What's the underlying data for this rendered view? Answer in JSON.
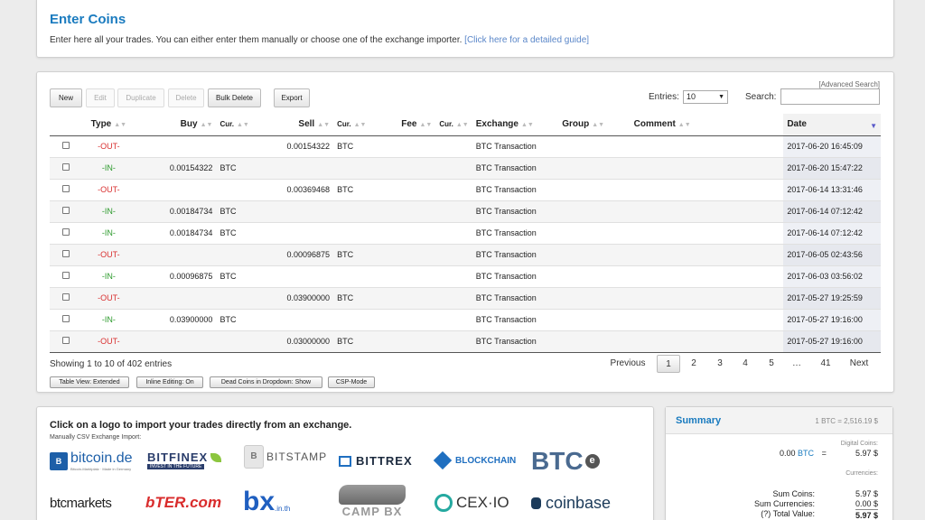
{
  "header": {
    "title": "Enter Coins",
    "description": "Enter here all your trades. You can either enter them manually or choose one of the exchange importer.",
    "guide_link": "[Click here for a detailed guide]"
  },
  "toolbar": {
    "new": "New",
    "edit": "Edit",
    "duplicate": "Duplicate",
    "delete": "Delete",
    "bulk_delete": "Bulk Delete",
    "export": "Export",
    "advanced_search": "[Advanced Search]",
    "entries_label": "Entries:",
    "entries_value": "10",
    "search_label": "Search:"
  },
  "table": {
    "columns": [
      "Type",
      "Buy",
      "Cur.",
      "Sell",
      "Cur.",
      "Fee",
      "Cur.",
      "Exchange",
      "Group",
      "Comment",
      "Date"
    ],
    "rows": [
      {
        "type": "-OUT-",
        "buy": "",
        "buy_cur": "",
        "sell": "0.00154322",
        "sell_cur": "BTC",
        "exchange": "BTC Transaction",
        "date": "2017-06-20 16:45:09"
      },
      {
        "type": "-IN-",
        "buy": "0.00154322",
        "buy_cur": "BTC",
        "sell": "",
        "sell_cur": "",
        "exchange": "BTC Transaction",
        "date": "2017-06-20 15:47:22"
      },
      {
        "type": "-OUT-",
        "buy": "",
        "buy_cur": "",
        "sell": "0.00369468",
        "sell_cur": "BTC",
        "exchange": "BTC Transaction",
        "date": "2017-06-14 13:31:46"
      },
      {
        "type": "-IN-",
        "buy": "0.00184734",
        "buy_cur": "BTC",
        "sell": "",
        "sell_cur": "",
        "exchange": "BTC Transaction",
        "date": "2017-06-14 07:12:42"
      },
      {
        "type": "-IN-",
        "buy": "0.00184734",
        "buy_cur": "BTC",
        "sell": "",
        "sell_cur": "",
        "exchange": "BTC Transaction",
        "date": "2017-06-14 07:12:42"
      },
      {
        "type": "-OUT-",
        "buy": "",
        "buy_cur": "",
        "sell": "0.00096875",
        "sell_cur": "BTC",
        "exchange": "BTC Transaction",
        "date": "2017-06-05 02:43:56"
      },
      {
        "type": "-IN-",
        "buy": "0.00096875",
        "buy_cur": "BTC",
        "sell": "",
        "sell_cur": "",
        "exchange": "BTC Transaction",
        "date": "2017-06-03 03:56:02"
      },
      {
        "type": "-OUT-",
        "buy": "",
        "buy_cur": "",
        "sell": "0.03900000",
        "sell_cur": "BTC",
        "exchange": "BTC Transaction",
        "date": "2017-05-27 19:25:59"
      },
      {
        "type": "-IN-",
        "buy": "0.03900000",
        "buy_cur": "BTC",
        "sell": "",
        "sell_cur": "",
        "exchange": "BTC Transaction",
        "date": "2017-05-27 19:16:00"
      },
      {
        "type": "-OUT-",
        "buy": "",
        "buy_cur": "",
        "sell": "0.03000000",
        "sell_cur": "BTC",
        "exchange": "BTC Transaction",
        "date": "2017-05-27 19:16:00"
      }
    ]
  },
  "footer": {
    "showing": "Showing 1 to 10 of 402 entries",
    "pagination": {
      "previous": "Previous",
      "pages": [
        "1",
        "2",
        "3",
        "4",
        "5",
        "…",
        "41"
      ],
      "current": "1",
      "next": "Next"
    },
    "options": [
      "Table View: Extended",
      "Inline Editing: On",
      "Dead Coins in Dropdown: Show",
      "CSP-Mode"
    ]
  },
  "import": {
    "title": "Click on a logo to import your trades directly from an exchange.",
    "subtitle": "Manually CSV Exchange Import:",
    "logos": {
      "bitcoin_de": "bitcoin.de",
      "bitcoin_de_tag": "Bitcoin-Marktplatz · Made in Germany",
      "bitfinex": "BITFINEX",
      "bitfinex_tag": "INVEST IN THE FUTURE",
      "bitstamp": "BITSTAMP",
      "bittrex": "BITTREX",
      "blockchain": "BLOCKCHAIN",
      "btce": "BTC",
      "btce_e": "e",
      "btcmarkets": "btcmarkets",
      "bter": "bTER.com",
      "bx": "bx",
      "bx_suffix": ".in.th",
      "campbx": "CAMP BX",
      "cexio": "CEX·IO",
      "coinbase": "coinbase"
    },
    "colors": {
      "bitcoin_de": "#1d5fa8",
      "bitfinex": "#2a3d6b",
      "bittrex": "#1c2a3e",
      "blockchain": "#1f6fc0",
      "btce": "#4a6a90",
      "bter": "#d92c2c",
      "bx": "#1f5fc0",
      "cexio": "#25a9a0",
      "coinbase": "#1c3b5a"
    }
  },
  "summary": {
    "title": "Summary",
    "rate": "1 BTC = 2,516.19 $",
    "digital_coins_label": "Digital Coins:",
    "btc_amount": "0.00",
    "btc_cur": "BTC",
    "equals": "=",
    "btc_value": "5.97 $",
    "currencies_label": "Currencies:",
    "sum_coins_label": "Sum Coins:",
    "sum_coins": "5.97 $",
    "sum_currencies_label": "Sum Currencies:",
    "sum_currencies": "0.00 $",
    "total_label": "(?) Total Value:",
    "total_value": "5.97 $"
  }
}
